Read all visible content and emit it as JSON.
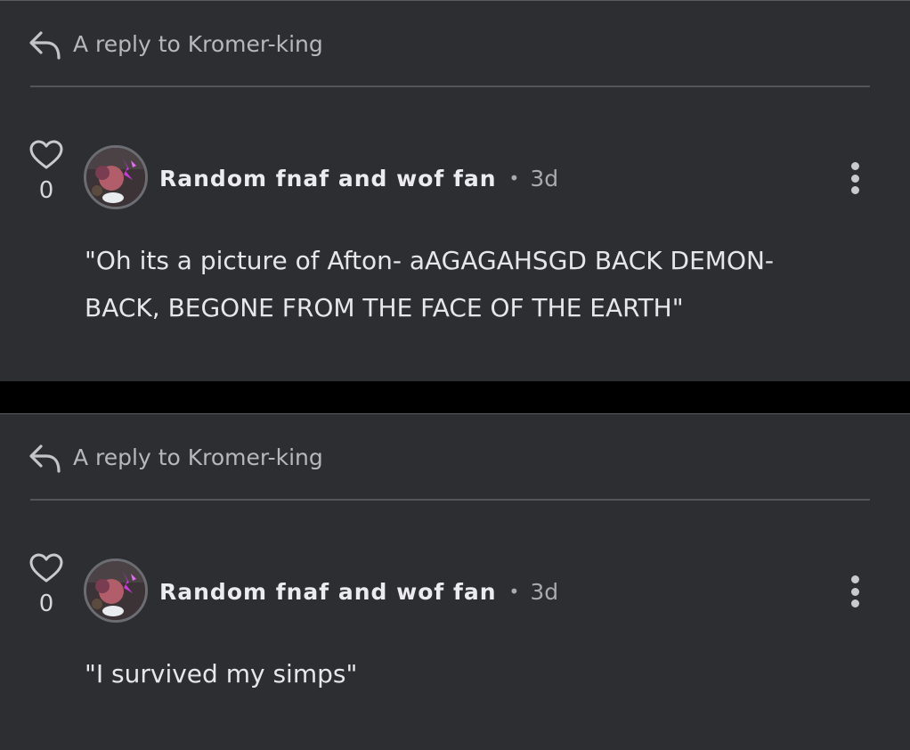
{
  "comments": [
    {
      "reply_label": "A reply to Kromer-king",
      "like_count": "0",
      "author": "Random fnaf and wof fan",
      "separator": "•",
      "time": "3d",
      "text": "\"Oh its a picture of Afton- aAGAGAHSGD BACK DEMON- BACK, BEGONE FROM THE FACE OF THE EARTH\""
    },
    {
      "reply_label": "A reply to Kromer-king",
      "like_count": "0",
      "author": "Random fnaf and wof fan",
      "separator": "•",
      "time": "3d",
      "text": "\"I survived my simps\""
    }
  ],
  "icons": {
    "reply": "reply-arrow-icon",
    "like": "heart-outline-icon",
    "more": "vertical-ellipsis-icon"
  },
  "colors": {
    "card_background": "#2d2e32",
    "page_background": "#000000",
    "primary_text": "#e6e7e9",
    "secondary_text": "#b7b8bc"
  }
}
